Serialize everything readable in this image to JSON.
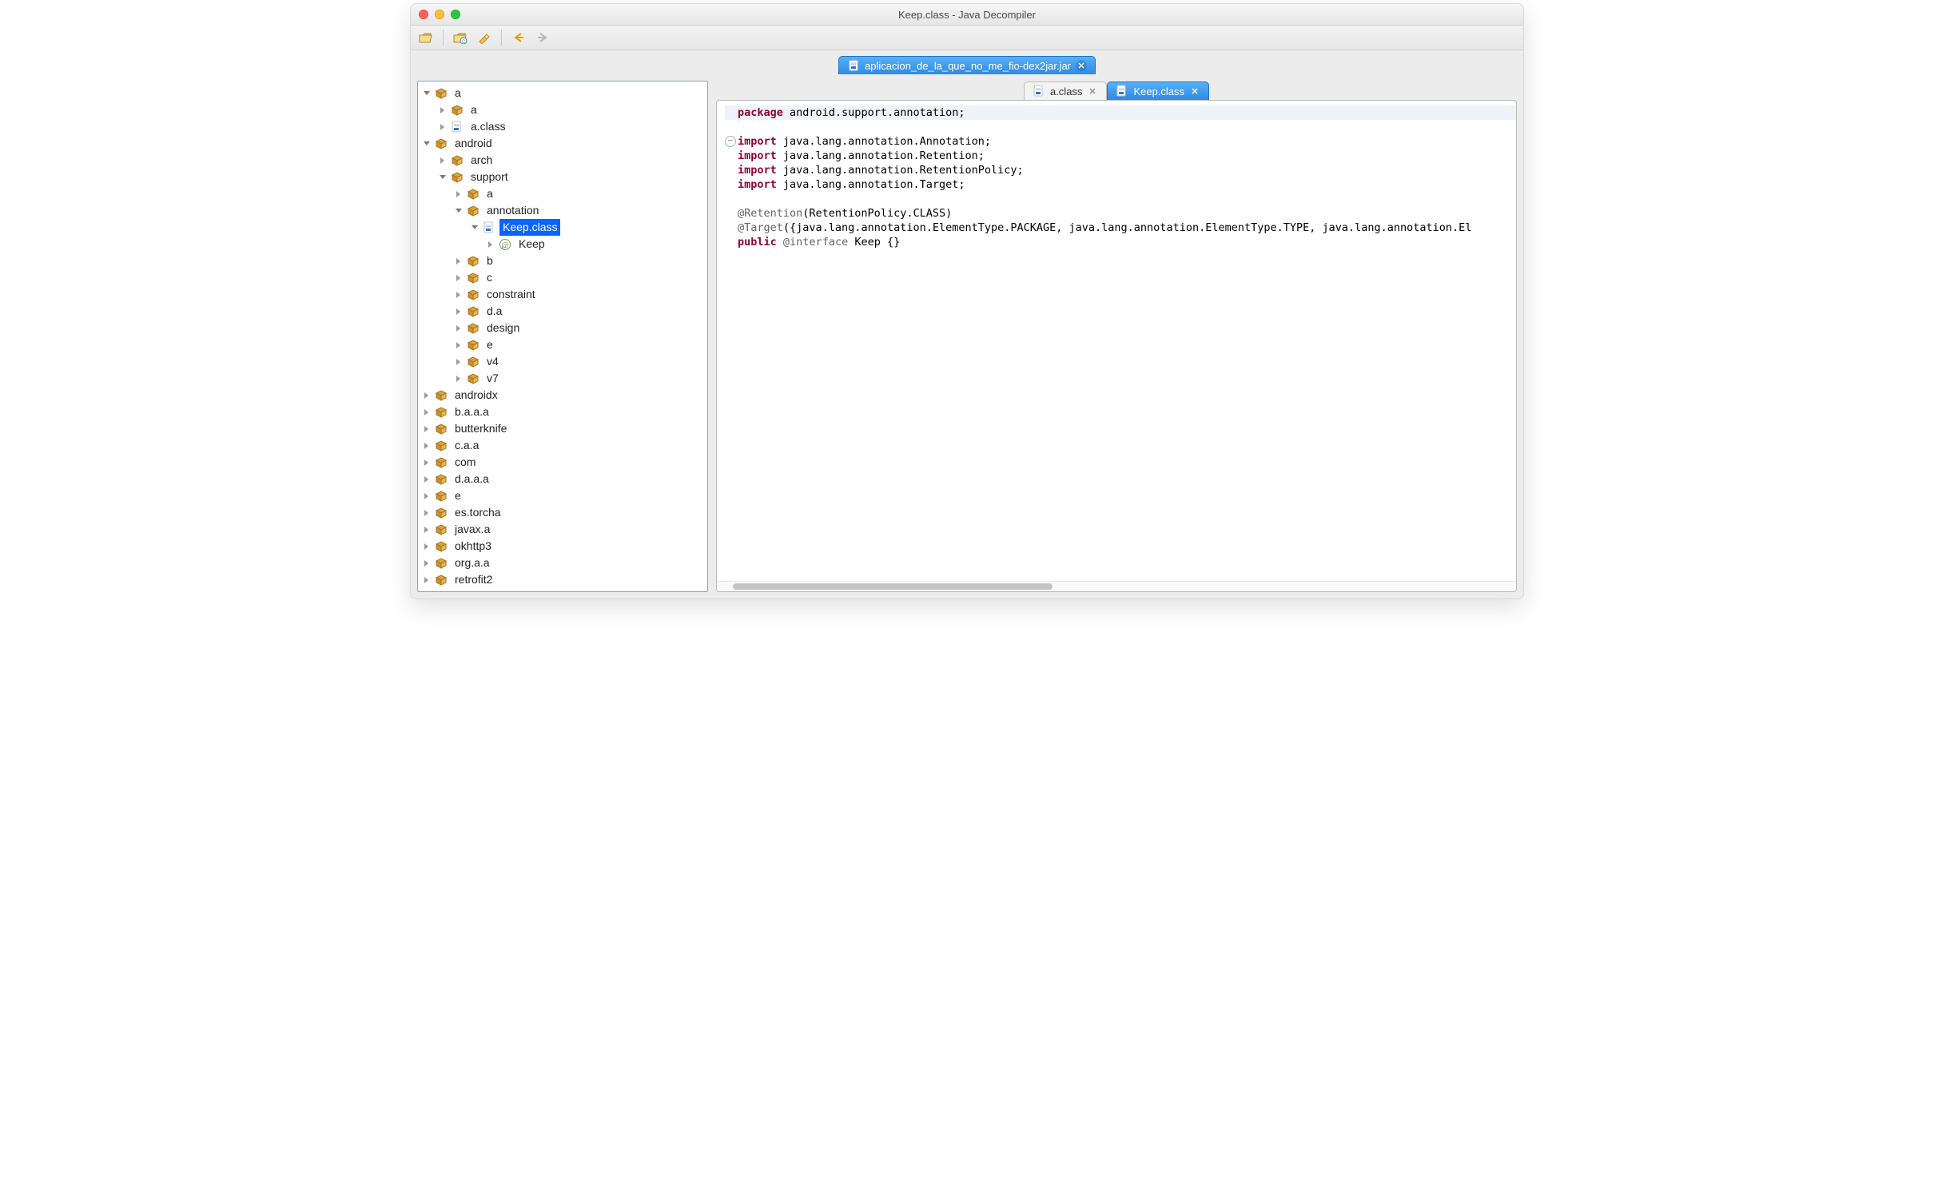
{
  "window": {
    "title": "Keep.class - Java Decompiler"
  },
  "toolbar": {
    "open_file": "Open File",
    "open_jar": "Open Type",
    "search": "Search",
    "back": "Back",
    "forward": "Forward"
  },
  "jar_tab": {
    "label": "aplicacion_de_la_que_no_me_fio-dex2jar.jar"
  },
  "file_tabs": [
    {
      "label": "a.class",
      "active": false,
      "closable": true
    },
    {
      "label": "Keep.class",
      "active": true,
      "closable": true
    }
  ],
  "tree": [
    {
      "depth": 0,
      "arrow": "open",
      "type": "pkg",
      "label": "a"
    },
    {
      "depth": 1,
      "arrow": "closed",
      "type": "pkg",
      "label": "a"
    },
    {
      "depth": 1,
      "arrow": "closed",
      "type": "class",
      "label": "a.class"
    },
    {
      "depth": 0,
      "arrow": "open",
      "type": "pkg",
      "label": "android"
    },
    {
      "depth": 1,
      "arrow": "closed",
      "type": "pkg",
      "label": "arch"
    },
    {
      "depth": 1,
      "arrow": "open",
      "type": "pkg",
      "label": "support"
    },
    {
      "depth": 2,
      "arrow": "closed",
      "type": "pkg",
      "label": "a"
    },
    {
      "depth": 2,
      "arrow": "open",
      "type": "pkg",
      "label": "annotation"
    },
    {
      "depth": 3,
      "arrow": "open",
      "type": "class",
      "label": "Keep.class",
      "selected": true
    },
    {
      "depth": 4,
      "arrow": "closed",
      "type": "anno",
      "label": "Keep"
    },
    {
      "depth": 2,
      "arrow": "closed",
      "type": "pkg",
      "label": "b"
    },
    {
      "depth": 2,
      "arrow": "closed",
      "type": "pkg",
      "label": "c"
    },
    {
      "depth": 2,
      "arrow": "closed",
      "type": "pkg",
      "label": "constraint"
    },
    {
      "depth": 2,
      "arrow": "closed",
      "type": "pkg",
      "label": "d.a"
    },
    {
      "depth": 2,
      "arrow": "closed",
      "type": "pkg",
      "label": "design"
    },
    {
      "depth": 2,
      "arrow": "closed",
      "type": "pkg",
      "label": "e"
    },
    {
      "depth": 2,
      "arrow": "closed",
      "type": "pkg",
      "label": "v4"
    },
    {
      "depth": 2,
      "arrow": "closed",
      "type": "pkg",
      "label": "v7"
    },
    {
      "depth": 0,
      "arrow": "closed",
      "type": "pkg",
      "label": "androidx"
    },
    {
      "depth": 0,
      "arrow": "closed",
      "type": "pkg",
      "label": "b.a.a.a"
    },
    {
      "depth": 0,
      "arrow": "closed",
      "type": "pkg",
      "label": "butterknife"
    },
    {
      "depth": 0,
      "arrow": "closed",
      "type": "pkg",
      "label": "c.a.a"
    },
    {
      "depth": 0,
      "arrow": "closed",
      "type": "pkg",
      "label": "com"
    },
    {
      "depth": 0,
      "arrow": "closed",
      "type": "pkg",
      "label": "d.a.a.a"
    },
    {
      "depth": 0,
      "arrow": "closed",
      "type": "pkg",
      "label": "e"
    },
    {
      "depth": 0,
      "arrow": "closed",
      "type": "pkg",
      "label": "es.torcha"
    },
    {
      "depth": 0,
      "arrow": "closed",
      "type": "pkg",
      "label": "javax.a"
    },
    {
      "depth": 0,
      "arrow": "closed",
      "type": "pkg",
      "label": "okhttp3"
    },
    {
      "depth": 0,
      "arrow": "closed",
      "type": "pkg",
      "label": "org.a.a"
    },
    {
      "depth": 0,
      "arrow": "closed",
      "type": "pkg",
      "label": "retrofit2"
    }
  ],
  "code_lines": [
    {
      "kind": "hl",
      "tokens": [
        {
          "t": "kw",
          "v": "package"
        },
        {
          "t": "",
          "v": " android.support.annotation;"
        }
      ]
    },
    {
      "kind": "",
      "tokens": [
        {
          "t": "",
          "v": ""
        }
      ]
    },
    {
      "kind": "fold",
      "tokens": [
        {
          "t": "kw",
          "v": "import"
        },
        {
          "t": "",
          "v": " java.lang.annotation.Annotation;"
        }
      ]
    },
    {
      "kind": "",
      "tokens": [
        {
          "t": "kw",
          "v": "import"
        },
        {
          "t": "",
          "v": " java.lang.annotation.Retention;"
        }
      ]
    },
    {
      "kind": "",
      "tokens": [
        {
          "t": "kw",
          "v": "import"
        },
        {
          "t": "",
          "v": " java.lang.annotation.RetentionPolicy;"
        }
      ]
    },
    {
      "kind": "",
      "tokens": [
        {
          "t": "kw",
          "v": "import"
        },
        {
          "t": "",
          "v": " java.lang.annotation.Target;"
        }
      ]
    },
    {
      "kind": "",
      "tokens": [
        {
          "t": "",
          "v": ""
        }
      ]
    },
    {
      "kind": "",
      "tokens": [
        {
          "t": "ann",
          "v": "@Retention"
        },
        {
          "t": "",
          "v": "(RetentionPolicy.CLASS)"
        }
      ]
    },
    {
      "kind": "",
      "tokens": [
        {
          "t": "ann",
          "v": "@Target"
        },
        {
          "t": "",
          "v": "({java.lang.annotation.ElementType.PACKAGE, java.lang.annotation.ElementType.TYPE, java.lang.annotation.El"
        }
      ]
    },
    {
      "kind": "",
      "tokens": [
        {
          "t": "kw",
          "v": "public"
        },
        {
          "t": "",
          "v": " "
        },
        {
          "t": "ann",
          "v": "@interface"
        },
        {
          "t": "",
          "v": " Keep {}"
        }
      ]
    }
  ],
  "hscroll": {
    "left_pct": 2,
    "width_pct": 40
  }
}
